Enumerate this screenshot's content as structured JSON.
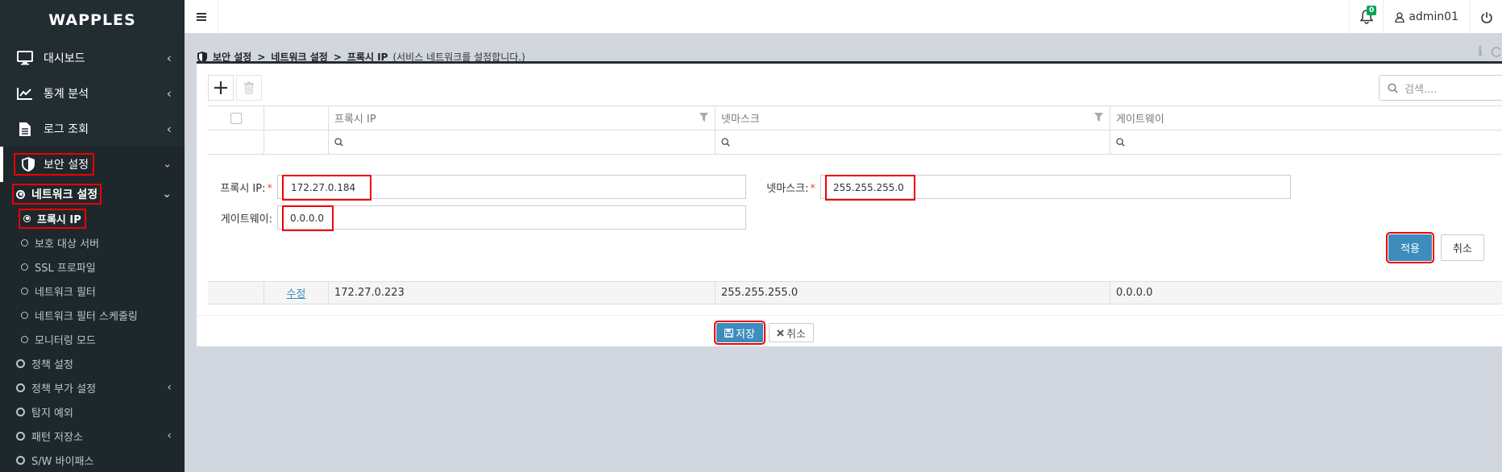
{
  "app": {
    "logo": "WAPPLES"
  },
  "sidebar": {
    "items": [
      {
        "label": "대시보드",
        "icon": "monitor-icon"
      },
      {
        "label": "통계 분석",
        "icon": "chart-line-icon"
      },
      {
        "label": "로그 조회",
        "icon": "document-icon"
      },
      {
        "label": "보안 설정",
        "icon": "shield-icon"
      }
    ],
    "network_settings": "네트워크 설정",
    "network_sub": [
      {
        "label": "프록시 IP"
      },
      {
        "label": "보호 대상 서버"
      },
      {
        "label": "SSL 프로파일"
      },
      {
        "label": "네트워크 필터"
      },
      {
        "label": "네트워크 필터 스케줄링"
      },
      {
        "label": "모니터링 모드"
      }
    ],
    "security_sub": [
      {
        "label": "정책 설정"
      },
      {
        "label": "정책 부가 설정"
      },
      {
        "label": "탐지 예외"
      },
      {
        "label": "패턴 저장소"
      },
      {
        "label": "S/W 바이패스"
      }
    ]
  },
  "topbar": {
    "notification_count": "0",
    "username": "admin01"
  },
  "breadcrumb": {
    "items": [
      "보안 설정",
      "네트워크 설정",
      "프록시 IP"
    ],
    "separator": ">",
    "description": "(서비스 네트워크를 설정합니다.)"
  },
  "toolbar": {
    "search_placeholder": "검색...."
  },
  "table": {
    "columns": [
      "프록시 IP",
      "넷마스크",
      "게이트웨이"
    ],
    "rows": [
      {
        "action": "수정",
        "proxy_ip": "172.27.0.223",
        "netmask": "255.255.255.0",
        "gateway": "0.0.0.0"
      }
    ]
  },
  "form": {
    "proxy_ip_label": "프록시 IP:",
    "proxy_ip_value": "172.27.0.184",
    "netmask_label": "넷마스크:",
    "netmask_value": "255.255.255.0",
    "gateway_label": "게이트웨이:",
    "gateway_value": "0.0.0.0",
    "required_mark": "*",
    "apply_label": "적용",
    "cancel_label": "취소"
  },
  "footer": {
    "save_label": "저장",
    "cancel_label": "취소"
  },
  "colors": {
    "sidebar_bg": "#222d32",
    "accent": "#3c8dbc",
    "highlight": "#e00000",
    "badge": "#00a65a"
  }
}
